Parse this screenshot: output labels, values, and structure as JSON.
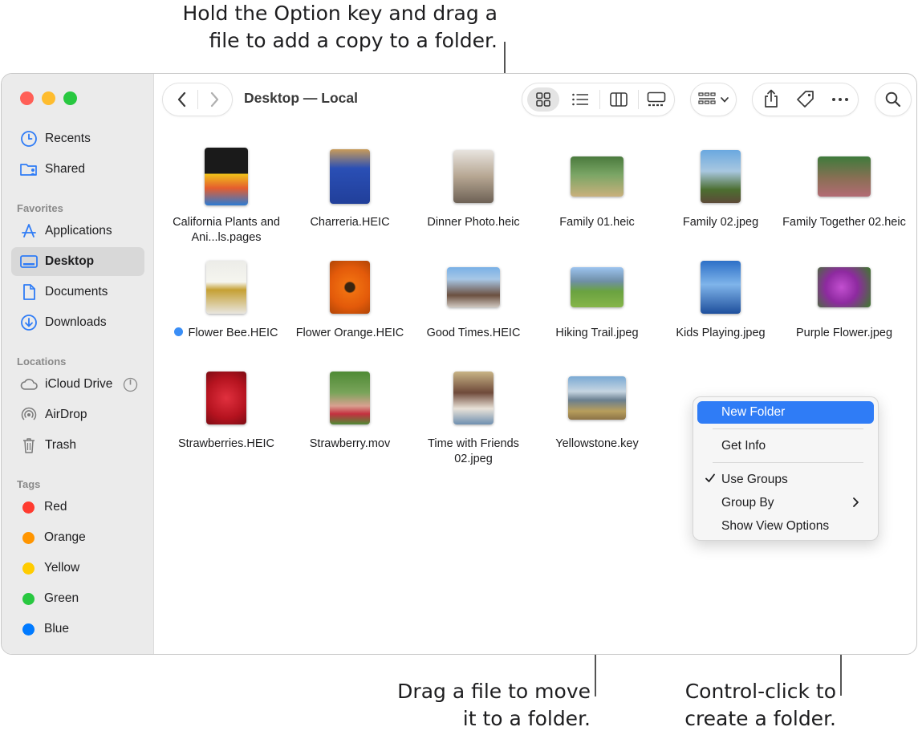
{
  "callouts": {
    "top": "Hold the Option key and drag a\nfile to add a copy to a folder.",
    "bottom_middle": "Drag a file to move\nit to a folder.",
    "bottom_right": "Control-click to\ncreate a folder."
  },
  "window": {
    "title": "Desktop — Local"
  },
  "sidebar": {
    "items_top": [
      {
        "label": "Recents",
        "icon": "clock-icon"
      },
      {
        "label": "Shared",
        "icon": "shared-folder-icon"
      }
    ],
    "favorites_header": "Favorites",
    "favorites": [
      {
        "label": "Applications",
        "icon": "applications-icon"
      },
      {
        "label": "Desktop",
        "icon": "desktop-icon",
        "selected": true
      },
      {
        "label": "Documents",
        "icon": "document-icon"
      },
      {
        "label": "Downloads",
        "icon": "download-icon"
      }
    ],
    "locations_header": "Locations",
    "locations": [
      {
        "label": "iCloud Drive",
        "icon": "cloud-icon"
      },
      {
        "label": "AirDrop",
        "icon": "airdrop-icon"
      },
      {
        "label": "Trash",
        "icon": "trash-icon"
      }
    ],
    "tags_header": "Tags",
    "tags": [
      {
        "label": "Red",
        "color": "#ff3b30"
      },
      {
        "label": "Orange",
        "color": "#ff9500"
      },
      {
        "label": "Yellow",
        "color": "#ffcc00"
      },
      {
        "label": "Green",
        "color": "#28c840"
      },
      {
        "label": "Blue",
        "color": "#007aff"
      }
    ]
  },
  "files": [
    {
      "name": "California Plants and Ani...ls.pages"
    },
    {
      "name": "Charreria.HEIC"
    },
    {
      "name": "Dinner Photo.heic"
    },
    {
      "name": "Family 01.heic"
    },
    {
      "name": "Family 02.jpeg"
    },
    {
      "name": "Family Together 02.heic"
    },
    {
      "name": "Flower Bee.HEIC",
      "tag_color": "#3a8ef6"
    },
    {
      "name": "Flower Orange.HEIC"
    },
    {
      "name": "Good Times.HEIC"
    },
    {
      "name": "Hiking Trail.jpeg"
    },
    {
      "name": "Kids Playing.jpeg"
    },
    {
      "name": "Purple Flower.jpeg"
    },
    {
      "name": "Strawberries.HEIC"
    },
    {
      "name": "Strawberry.mov"
    },
    {
      "name": "Time with Friends 02.jpeg"
    },
    {
      "name": "Yellowstone.key"
    }
  ],
  "context_menu": {
    "new_folder": "New Folder",
    "get_info": "Get Info",
    "use_groups": "Use Groups",
    "use_groups_checked": true,
    "group_by": "Group By",
    "show_view_options": "Show View Options",
    "highlight_color": "#2f7cf6"
  }
}
